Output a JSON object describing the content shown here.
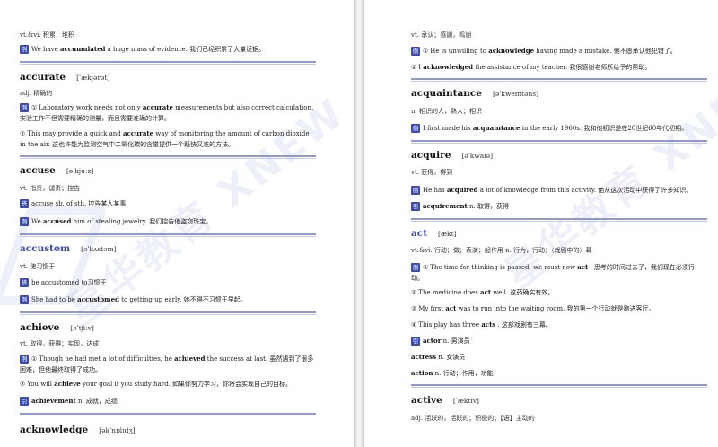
{
  "left": {
    "top_pos": "vt.&vi. 积累，堆积",
    "top_example": {
      "tag": "例",
      "pre": "We have ",
      "bold": "accumulated",
      "post": " a huge mass of evidence. 我们已经积累了大量证据。"
    },
    "accurate": {
      "word": "accurate",
      "ipa": "[ˈækjərət]",
      "pos": "adj. 精确的",
      "ex1": {
        "tag": "例",
        "num": "①",
        "pre": "Laboratory work needs not only ",
        "bold": "accurate",
        "post": " measurements but also correct calculation. 实验工作不但需要精确的测量，而且需要准确的计算。"
      },
      "ex2": {
        "num": "②",
        "pre": "This may provide a quick and ",
        "bold": "accurate",
        "post": " way of monitoring the amount of carbon dioxide in the air. 这也许能为监测空气中二氧化碳的含量提供一个既快又准的方法。"
      }
    },
    "accuse": {
      "word": "accuse",
      "ipa": "[əˈkjuːz]",
      "pos": "vt. 指责，谴责；控告",
      "phrase": {
        "tag": "搭",
        "text": "accuse sb. of sth. 控告某人某事"
      },
      "ex": {
        "tag": "例",
        "pre": "We ",
        "bold": "accused",
        "post": " him of stealing jewelry. 我们控告他盗窃珠宝。"
      }
    },
    "accustom": {
      "word": "accustom",
      "ipa": "[əˈkʌstəm]",
      "pos": "vt. 使习惯于",
      "phrase": {
        "tag": "搭",
        "text": "be accustomed to习惯于"
      },
      "ex": {
        "tag": "例",
        "pre": "She had to be ",
        "bold": "accustomed",
        "post": " to getting up early. 她不得不习惯于早起。"
      }
    },
    "achieve": {
      "word": "achieve",
      "ipa": "[əˈtʃiːv]",
      "pos": "vt. 取得，获得；实现，达成",
      "ex1": {
        "tag": "例",
        "num": "①",
        "pre": "Though he had met a lot of difficulties, he ",
        "bold": "achieved",
        "post": " the success at last. 虽然遇到了很多困难，但他最终取得了成功。"
      },
      "ex2": {
        "num": "②",
        "pre": "You will ",
        "bold": "achieve",
        "post": " your goal if you study hard. 如果你努力学习，你将会实现自己的目标。"
      },
      "deriv": {
        "tag": "引",
        "bold": "achievement",
        "post": " n. 成就，成绩"
      }
    },
    "acknowledge": {
      "word": "acknowledge",
      "ipa": "[əkˈnɒlɪdʒ]"
    }
  },
  "right": {
    "top_pos": "vt. 承认；感谢，鸣谢",
    "top_ex1": {
      "tag": "例",
      "num": "①",
      "pre": "He is unwilling to ",
      "bold": "acknowledge",
      "post": " having made a mistake. 他不愿承认他犯错了。"
    },
    "top_ex2": {
      "num": "②",
      "pre": "I ",
      "bold": "acknowledged",
      "post": " the assistance of my teacher. 我很感谢老师所给予的帮助。"
    },
    "acquaintance": {
      "word": "acquaintance",
      "ipa": "[əˈkweɪntəns]",
      "pos": "n. 相识的人，熟人；相识",
      "ex": {
        "tag": "例",
        "pre": "I first made his ",
        "bold": "acquaintance",
        "post": " in the early 1960s. 我和他初识是在20世纪60年代初期。"
      }
    },
    "acquire": {
      "word": "acquire",
      "ipa": "[əˈkwaɪə]",
      "pos": "vt. 获得，得到",
      "ex": {
        "tag": "例",
        "pre": "He has ",
        "bold": "acquired",
        "post": " a lot of knowledge from this activity. 他从这次活动中获得了许多知识。"
      },
      "deriv": {
        "tag": "引",
        "bold": "acquirement",
        "post": " n. 取得，获得"
      }
    },
    "act": {
      "word": "act",
      "ipa": "[ækt]",
      "pos": "vt.&vi. 行动；做；表演；起作用 n. 行为，行动；（戏剧中的）幕",
      "ex1": {
        "tag": "例",
        "num": "①",
        "pre": "The time for thinking is passed; we must now ",
        "bold": "act",
        "post": " . 思考的时间过去了，我们现在必须行动。"
      },
      "ex2": {
        "num": "②",
        "pre": "The medicine does ",
        "bold": "act",
        "post": " well. 这药确实有效。"
      },
      "ex3": {
        "num": "③",
        "pre": "My first ",
        "bold": "act",
        "post": " was to run into the waiting room. 我的第一个行动就是跑进客厅。"
      },
      "ex4": {
        "num": "④",
        "pre": "This play has three ",
        "bold": "acts",
        "post": " . 这部戏剧有三幕。"
      },
      "deriv1": {
        "tag": "引",
        "bold": "actor",
        "post": " n. 男演员"
      },
      "deriv2": {
        "bold": "actress",
        "post": " n. 女演员"
      },
      "deriv3": {
        "bold": "action",
        "post": " n. 行动；作用，功能"
      }
    },
    "active": {
      "word": "active",
      "ipa": "[ˈæktɪv]",
      "pos": "adj. 活跃的，活跃的；积极的；【语】主动的"
    }
  },
  "watermark": "星华教育 XNEW"
}
